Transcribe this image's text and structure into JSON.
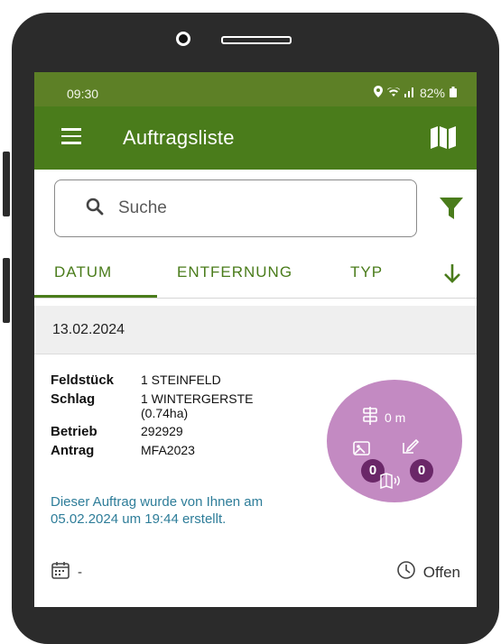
{
  "status_bar": {
    "time": "09:30",
    "battery": "82%"
  },
  "app_bar": {
    "title": "Auftragsliste"
  },
  "search": {
    "placeholder": "Suche"
  },
  "tabs": [
    {
      "label": "DATUM",
      "selected": true
    },
    {
      "label": "ENTFERNUNG",
      "selected": false
    },
    {
      "label": "TYP",
      "selected": false
    }
  ],
  "date_header": "13.02.2024",
  "card": {
    "fields": [
      {
        "key": "Feldstück",
        "value": "1 STEINFELD"
      },
      {
        "key": "Schlag",
        "value": "1 WINTERGERSTE (0.74ha)"
      },
      {
        "key": "Betrieb",
        "value": "292929"
      },
      {
        "key": "Antrag",
        "value": "MFA2023"
      }
    ],
    "note": "Dieser Auftrag wurde von Ihnen am 05.02.2024 um 19:44 erstellt.",
    "badge": {
      "distance": "0 m",
      "count_photos": "0",
      "count_edits": "0"
    },
    "date_value": "-",
    "status": "Offen"
  },
  "colors": {
    "primary": "#4a7c1b",
    "status_bar": "#5d8026",
    "badge_bg": "#c38ac2",
    "badge_count": "#6a2768",
    "note_text": "#2e7d99"
  }
}
